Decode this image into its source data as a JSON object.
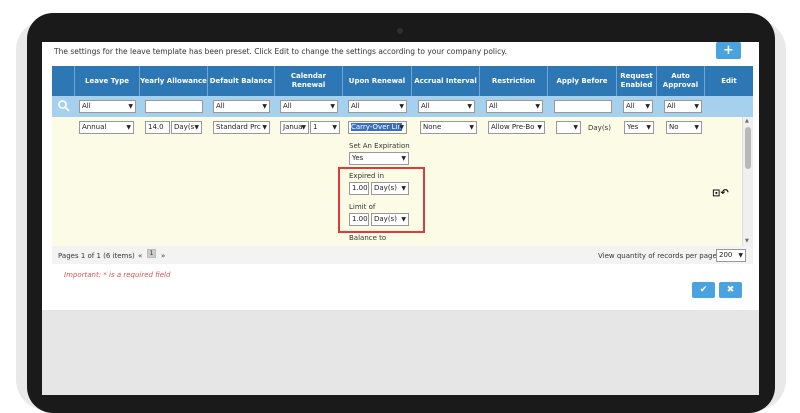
{
  "notice": "The settings for the leave template has been preset. Click Edit to change the settings according to your company policy.",
  "add_label": "+",
  "columns": [
    "Leave Type",
    "Yearly Allowance",
    "Default Balance",
    "Calendar Renewal",
    "Upon Renewal",
    "Accrual Interval",
    "Restriction",
    "Apply Before",
    "Request Enabled",
    "Auto Approval",
    "Edit"
  ],
  "filters": {
    "leave_type": "All",
    "yearly_allowance": "",
    "default_balance": "All",
    "calendar_renewal": "All",
    "upon_renewal": "All",
    "accrual_interval": "All",
    "restriction": "All",
    "apply_before": "",
    "request_enabled": "All",
    "auto_approval": "All"
  },
  "row": {
    "leave_type": "Annual",
    "yearly_allowance_value": "14.0",
    "yearly_allowance_unit": "Day(s",
    "default_balance": "Standard Prc",
    "calendar_month": "Janua",
    "calendar_day": "1",
    "upon_renewal": "Carry-Over Lin",
    "accrual_interval": "None",
    "restriction": "Allow Pre-Bo",
    "apply_before_value": "",
    "apply_before_unit": "Day(s)",
    "request_enabled": "Yes",
    "auto_approval": "No",
    "set_expiration_label": "Set An Expiration",
    "set_expiration_value": "Yes",
    "expired_in_label": "Expired in",
    "expired_in_value": "1.00(",
    "expired_in_unit": "Day(s)",
    "limit_label": "Limit of",
    "limit_value": "1.00(",
    "limit_unit": "Day(s)",
    "balance_to_label": "Balance to"
  },
  "footer": {
    "pages": "Pages 1 of 1 (6 items)",
    "page_prev": "«",
    "page_current": "1",
    "page_next": "»",
    "records_label": "View quantity of records per page",
    "records_value": "200"
  },
  "required_note": "Important: * is a required field",
  "buttons": {
    "save": "✔",
    "cancel": "✖"
  },
  "colors": {
    "header": "#2e77b5",
    "filter": "#a6d1ee",
    "row": "#fbfbe6",
    "accent": "#4aa3df",
    "highlight": "#e03a3a"
  }
}
